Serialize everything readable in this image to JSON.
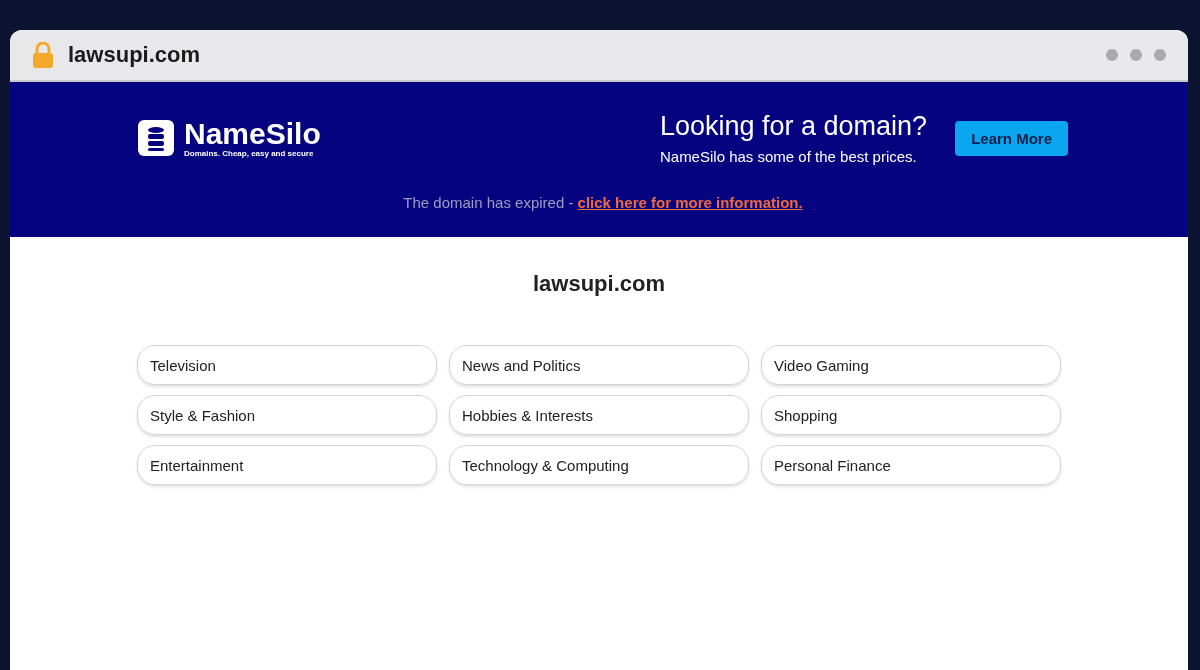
{
  "browser": {
    "url": "lawsupi.com"
  },
  "banner": {
    "logo_name": "NameSilo",
    "logo_tagline": "Domains. Cheap, easy and secure",
    "heading": "Looking for a domain?",
    "subheading": "NameSilo has some of the best prices.",
    "button": "Learn More",
    "notice": "The domain has expired - ",
    "notice_link": "click here for more information."
  },
  "page": {
    "title": "lawsupi.com",
    "links": [
      {
        "label": "Television"
      },
      {
        "label": "News and Politics"
      },
      {
        "label": "Video Gaming"
      },
      {
        "label": "Style & Fashion"
      },
      {
        "label": "Hobbies & Interests"
      },
      {
        "label": "Shopping"
      },
      {
        "label": "Entertainment"
      },
      {
        "label": "Technology & Computing"
      },
      {
        "label": "Personal Finance"
      }
    ]
  }
}
